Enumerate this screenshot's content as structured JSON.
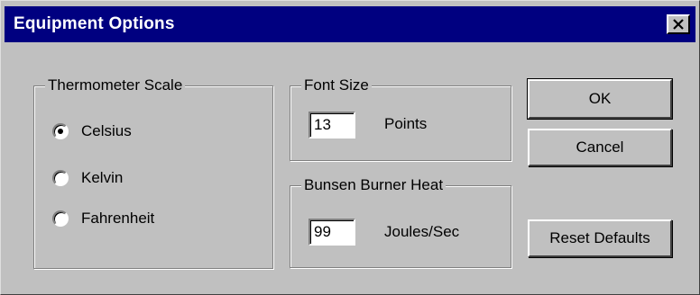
{
  "window": {
    "title": "Equipment Options",
    "close_icon": "close-icon"
  },
  "thermometer": {
    "legend": "Thermometer Scale",
    "options": [
      {
        "label": "Celsius",
        "checked": true
      },
      {
        "label": "Kelvin",
        "checked": false
      },
      {
        "label": "Fahrenheit",
        "checked": false
      }
    ]
  },
  "font_size": {
    "legend": "Font Size",
    "value": "13",
    "unit": "Points"
  },
  "bunsen": {
    "legend": "Bunsen Burner Heat",
    "value": "99",
    "unit": "Joules/Sec"
  },
  "buttons": {
    "ok": "OK",
    "cancel": "Cancel",
    "reset": "Reset Defaults"
  },
  "colors": {
    "titlebar": "#000080",
    "face": "#c0c0c0"
  }
}
